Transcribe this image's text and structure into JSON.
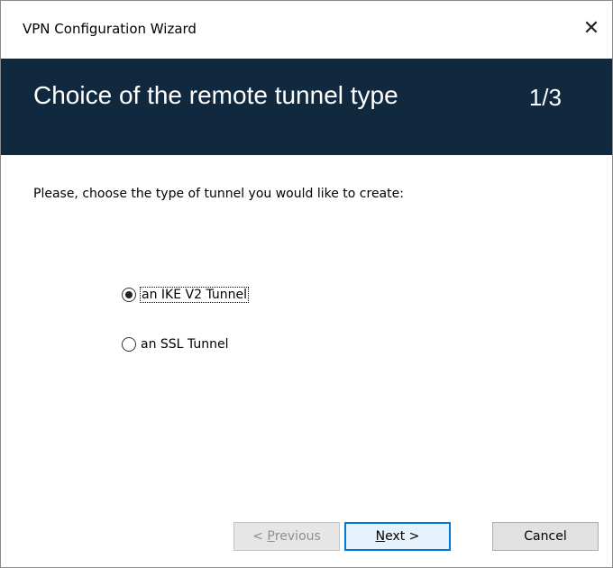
{
  "window": {
    "title": "VPN Configuration Wizard",
    "close_glyph": "✕"
  },
  "banner": {
    "title": "Choice of the remote tunnel type",
    "step": "1/3",
    "background_color": "#11293f"
  },
  "prompt": "Please, choose the type of tunnel you would like to create:",
  "options": [
    {
      "label": "an IKE V2 Tunnel",
      "checked": true,
      "focused": true
    },
    {
      "label": "an SSL Tunnel",
      "checked": false,
      "focused": false
    }
  ],
  "buttons": {
    "previous": {
      "prefix": "< ",
      "accel": "P",
      "rest": "revious",
      "enabled": false
    },
    "next": {
      "accel": "N",
      "rest": "ext >",
      "enabled": true,
      "default": true
    },
    "cancel": {
      "label": "Cancel",
      "enabled": true
    }
  },
  "icons": {
    "close": "close-icon",
    "radio": "radio-icon"
  }
}
